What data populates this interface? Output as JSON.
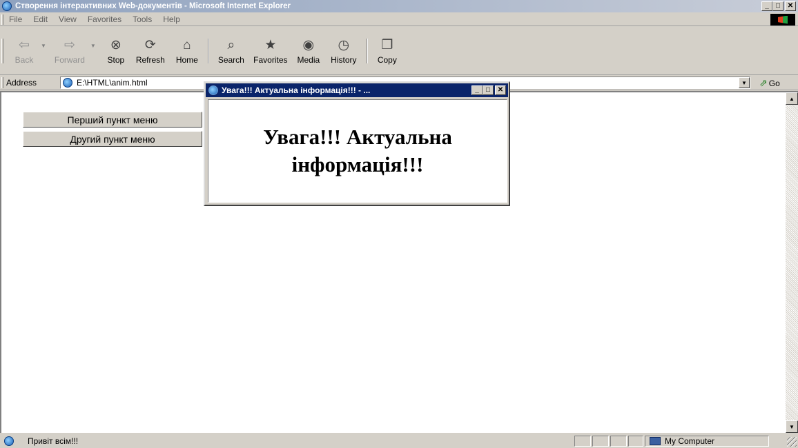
{
  "window": {
    "title": "Створення інтерактивних Web-документів - Microsoft Internet Explorer"
  },
  "menubar": {
    "items": [
      "File",
      "Edit",
      "View",
      "Favorites",
      "Tools",
      "Help"
    ]
  },
  "toolbar": {
    "back": "Back",
    "forward": "Forward",
    "stop": "Stop",
    "refresh": "Refresh",
    "home": "Home",
    "search": "Search",
    "favorites": "Favorites",
    "media": "Media",
    "history": "History",
    "copy": "Copy"
  },
  "address": {
    "label": "Address",
    "value": "E:\\HTML\\anim.html",
    "go": "Go"
  },
  "page": {
    "menu_items": [
      "Перший пункт меню",
      "Другий пункт меню"
    ]
  },
  "popup": {
    "title": "Увага!!! Актуальна інформація!!! - ...",
    "message": "Увага!!! Актуальна інформація!!!"
  },
  "status": {
    "text": "Привіт всім!!!",
    "zone": "My Computer"
  }
}
